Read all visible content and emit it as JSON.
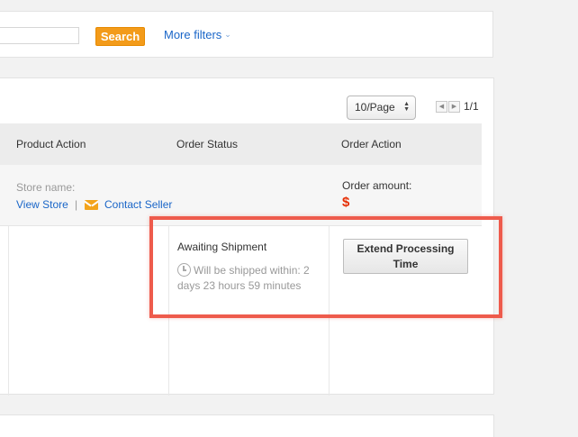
{
  "filters": {
    "search_label": "Search",
    "more_filters_label": "More filters",
    "more_filters_icon": "chevron-down-icon"
  },
  "pagination": {
    "per_page": "10/Page",
    "page_info": "1/1"
  },
  "table": {
    "columns": [
      "Product Action",
      "Order Status",
      "Order Action"
    ]
  },
  "store": {
    "store_name_label": "Store name:",
    "view_store_label": "View Store",
    "separator": "|",
    "contact_seller_label": "Contact Seller",
    "order_amount_label": "Order amount:",
    "currency_symbol": "$"
  },
  "order": {
    "status": "Awaiting Shipment",
    "ship_countdown": "Will be shipped within: 2 days 23 hours 59 minutes",
    "extend_button_label": "Extend Processing Time"
  },
  "colors": {
    "accent_orange": "#f39b1a",
    "link_blue": "#1a66c8",
    "price_red": "#e62e04",
    "highlight_red": "#ee5b4c"
  }
}
